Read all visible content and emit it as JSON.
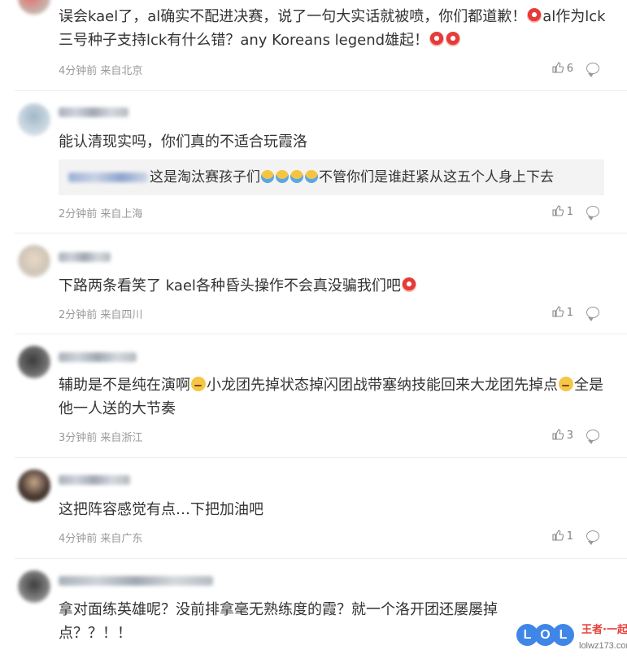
{
  "comments": [
    {
      "text": "误会kael了，al确实不配进决赛，说了一句大实话就被喷，你们都道歉！",
      "text_after_emoji": "al作为lck三号种子支持lck有什么错？any Koreans legend雄起！",
      "meta": "4分钟前 来自北京",
      "likes": "6"
    },
    {
      "text": "能认清现实吗，你们真的不适合玩霞洛",
      "quote": {
        "text_before": "这是淘汰赛孩子们",
        "text_after": "不管你们是谁赶紧从这五个人身上下去"
      },
      "meta": "2分钟前 来自上海",
      "likes": "1"
    },
    {
      "text": "下路两条看笑了 kael各种昏头操作不会真没骗我们吧",
      "meta": "2分钟前 来自四川",
      "likes": "1"
    },
    {
      "text_before": "辅助是不是纯在演啊",
      "text_middle": "小龙团先掉状态掉闪团战带塞纳技能回来大龙团先掉点",
      "text_after": "全是他一人送的大节奏",
      "meta": "3分钟前 来自浙江",
      "likes": "3"
    },
    {
      "text": "这把阵容感觉有点…下把加油吧",
      "meta": "4分钟前 来自广东",
      "likes": "1"
    },
    {
      "text": "拿对面练英雄呢？没前排拿毫无熟练度的霞？就一个洛开团还屡屡掉点？？！！"
    }
  ],
  "watermark": {
    "letters": [
      "L",
      "O",
      "L"
    ],
    "title": "王者·一起上",
    "url": "lolwz173.com"
  },
  "colors": {
    "text": "#333333",
    "meta": "#999999",
    "quote_bg": "#f3f3f3",
    "watermark_blue": "#3f86e7"
  }
}
